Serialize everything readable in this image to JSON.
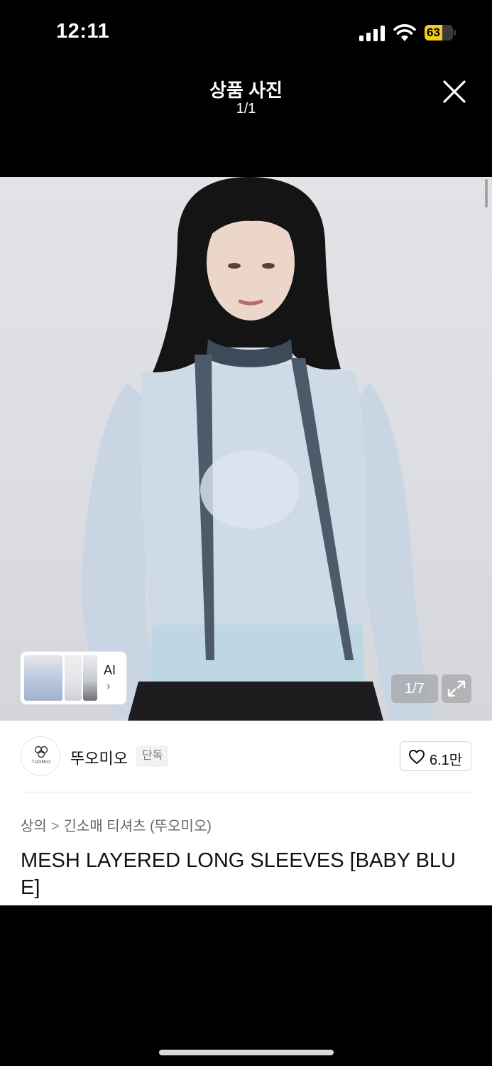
{
  "status_bar": {
    "time": "12:11",
    "battery": "63",
    "battery_level": 0.63,
    "battery_color": "#f5cc1a"
  },
  "viewer": {
    "title": "상품 사진",
    "page_indicator": "1/1",
    "close_icon": "close-icon"
  },
  "image": {
    "counter": "1/7",
    "expand_icon": "expand-icon",
    "ai_label": "AI",
    "ai_chevron": "›"
  },
  "brand": {
    "logo_text": "TUOMIO",
    "name": "뚜오미오",
    "badge": "단독",
    "likes": "6.1만"
  },
  "breadcrumb": {
    "items": [
      "상의",
      "긴소매 티셔츠 (뚜오미오)"
    ],
    "separator": ">"
  },
  "product": {
    "title": "MESH LAYERED LONG SLEEVES [BABY BLUE]"
  }
}
